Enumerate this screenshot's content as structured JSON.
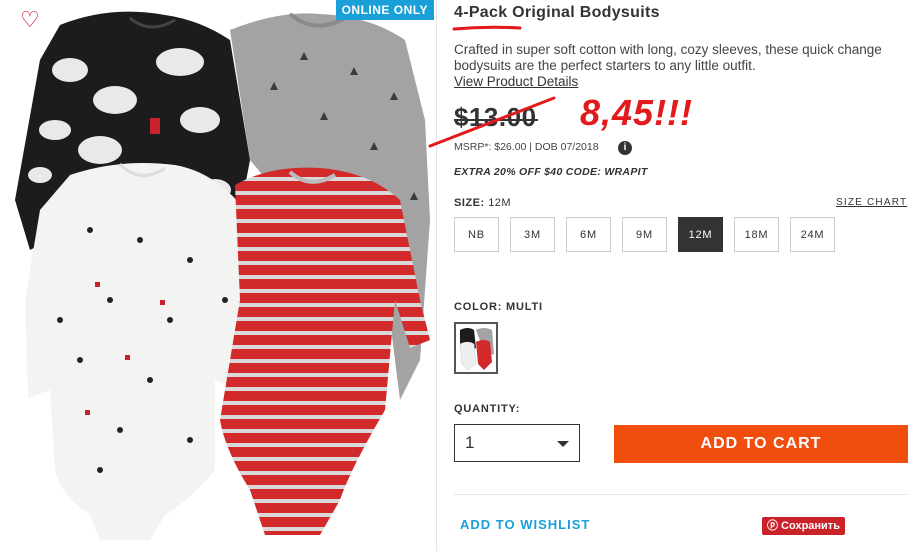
{
  "badge": {
    "label": "ONLINE ONLY"
  },
  "product": {
    "title": "4-Pack Original Bodysuits",
    "description": "Crafted in super soft cotton with long, cozy sleeves, these quick change bodysuits are the perfect starters to any little outfit.",
    "details_link": "View Product Details",
    "price": "$13.00",
    "annotation_price": "8,45!!!",
    "msrp": "MSRP*: $26.00 | DOB 07/2018",
    "info_icon": "i",
    "promo": "EXTRA 20% OFF $40 CODE: WRAPIT"
  },
  "size": {
    "label": "SIZE:",
    "selected": "12M",
    "chart_link": "SIZE CHART",
    "options": [
      "NB",
      "3M",
      "6M",
      "9M",
      "12M",
      "18M",
      "24M"
    ]
  },
  "color": {
    "label": "COLOR: MULTI"
  },
  "quantity": {
    "label": "QUANTITY:",
    "value": "1"
  },
  "actions": {
    "add_to_cart": "ADD TO CART",
    "add_to_wishlist": "ADD TO WISHLIST",
    "save": "ⓟ Сохранить"
  },
  "icons": {
    "heart": "heart-icon",
    "info": "info-icon",
    "dropdown": "chevron-down-icon"
  },
  "colors": {
    "accent_blue": "#1a9fd9",
    "cart_orange": "#f04e0e",
    "annotation_red": "#e31a1c",
    "pinterest_red": "#c92228",
    "selected_dark": "#333333"
  }
}
